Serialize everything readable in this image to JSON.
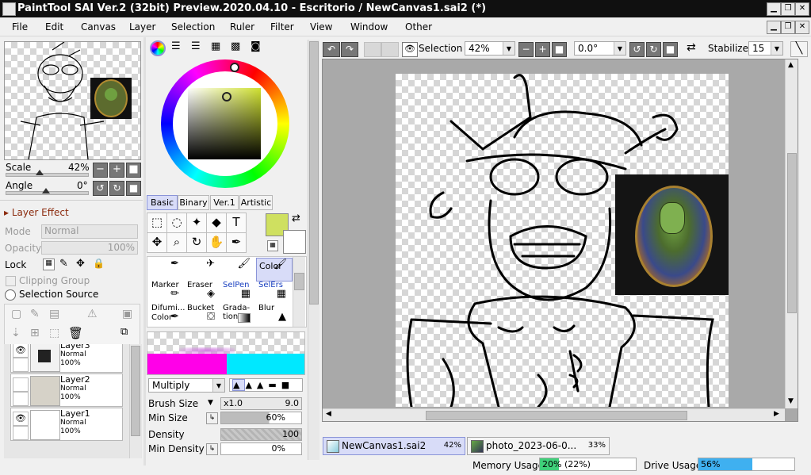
{
  "window": {
    "title": "PaintTool SAI Ver.2 (32bit) Preview.2020.04.10 - Escritorio / NewCanvas1.sai2 (*)"
  },
  "menu": [
    "File",
    "Edit",
    "Canvas",
    "Layer",
    "Selection",
    "Ruler",
    "Filter",
    "View",
    "Window",
    "Other"
  ],
  "navigator": {
    "scale_label": "Scale",
    "scale_value": "42%",
    "angle_label": "Angle",
    "angle_value": "0°"
  },
  "layer_panel": {
    "effect_label": "Layer Effect",
    "mode_label": "Mode",
    "mode_value": "Normal",
    "opacity_label": "Opacity",
    "opacity_value": "100%",
    "lock_label": "Lock",
    "clipping_label": "Clipping Group",
    "selection_source_label": "Selection Source",
    "layers": [
      {
        "name": "Layer3",
        "mode": "Normal",
        "opacity": "100%",
        "visible": true
      },
      {
        "name": "Layer2",
        "mode": "Normal",
        "opacity": "100%",
        "visible": false
      },
      {
        "name": "Layer1",
        "mode": "Normal",
        "opacity": "100%",
        "visible": true
      }
    ]
  },
  "color_panel": {
    "tabs": [
      "Basic",
      "Binary",
      "Ver.1",
      "Artistic"
    ],
    "active_tab": "Basic",
    "primary_color": "#cfe060",
    "secondary_color": "#ffffff"
  },
  "brushes": [
    {
      "label": "",
      "icon": "pen-icon"
    },
    {
      "label": "",
      "icon": "airbrush-icon"
    },
    {
      "label": "",
      "icon": "brush-icon"
    },
    {
      "label": "Color",
      "icon": "color-brush-icon"
    },
    {
      "label": "Marker",
      "icon": "marker-icon"
    },
    {
      "label": "Eraser",
      "icon": "eraser-icon"
    },
    {
      "label": "SelPen",
      "icon": "selpen-icon"
    },
    {
      "label": "SelErs",
      "icon": "selers-icon"
    },
    {
      "label": "Difumi...",
      "icon": "blur-icon"
    },
    {
      "label": "Bucket",
      "icon": "bucket-icon"
    },
    {
      "label": "Grada-\ntion",
      "icon": "gradation-icon"
    },
    {
      "label": "Blur",
      "icon": "blur-drop-icon"
    },
    {
      "label": "Color",
      "icon": "color-icon"
    }
  ],
  "brush_settings": {
    "blend_mode": "Multiply",
    "brush_size_label": "Brush Size",
    "brush_size_mult": "x1.0",
    "brush_size_value": "9.0",
    "min_size_label": "Min Size",
    "min_size_value": "60%",
    "density_label": "Density",
    "density_value": "100",
    "min_density_label": "Min Density",
    "min_density_value": "0%"
  },
  "toolbar": {
    "selection_label": "Selection",
    "zoom_value": "42%",
    "angle_value": "0.0°",
    "stabilizer_label": "Stabilizer",
    "stabilizer_value": "15"
  },
  "doc_tabs": [
    {
      "name": "NewCanvas1.sai2",
      "zoom": "42%",
      "active": true
    },
    {
      "name": "photo_2023-06-0...",
      "zoom": "33%",
      "active": false
    }
  ],
  "status": {
    "memory_label": "Memory Usage",
    "memory_value": "20% (22%)",
    "memory_fraction": 0.2,
    "drive_label": "Drive Usage",
    "drive_value": "56%",
    "drive_fraction": 0.56,
    "memory_color": "#3fd07a",
    "drive_color": "#3fb0f0"
  }
}
